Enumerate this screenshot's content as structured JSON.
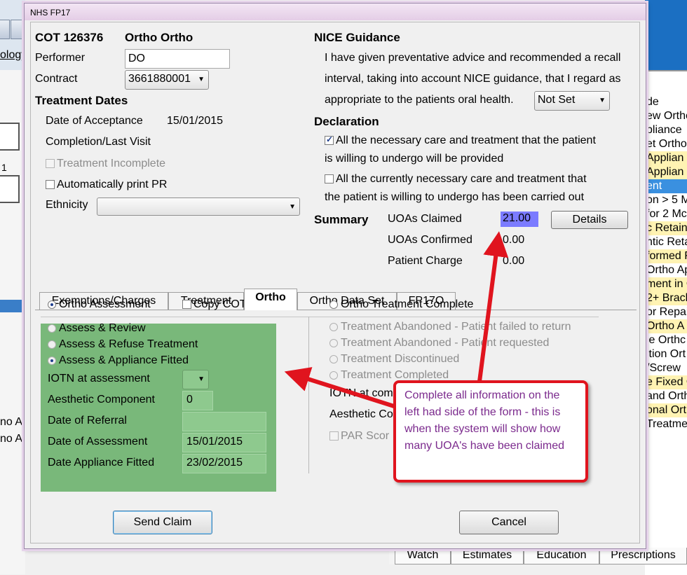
{
  "window": {
    "title": "NHS FP17"
  },
  "header": {
    "cot": "COT 126376",
    "patient_name": "Ortho Ortho"
  },
  "performer": {
    "label": "Performer",
    "value": "DO"
  },
  "contract": {
    "label": "Contract",
    "value": "3661880001"
  },
  "treatment_dates": {
    "heading": "Treatment Dates",
    "acceptance_label": "Date of Acceptance",
    "acceptance_value": "15/01/2015",
    "completion_label": "Completion/Last Visit",
    "incomplete_label": "Treatment Incomplete",
    "auto_print_label": "Automatically print PR",
    "ethnicity_label": "Ethnicity",
    "ethnicity_value": ""
  },
  "nice": {
    "heading": "NICE Guidance",
    "line1": "I have given preventative advice and recommended a recall",
    "line2": "interval, taking into account NICE guidance, that I regard as",
    "line3": "appropriate to the patients oral health.",
    "select_value": "Not Set"
  },
  "declaration": {
    "heading": "Declaration",
    "item1_line1": "All the necessary care and treatment that the patient",
    "item1_line2": "is willing to undergo will be provided",
    "item1_checked": true,
    "item2_line1": "All the currently necessary care and treatment that",
    "item2_line2": "the patient is willing to undergo has been carried out",
    "item2_checked": false
  },
  "summary": {
    "heading": "Summary",
    "uoas_claimed_label": "UOAs Claimed",
    "uoas_claimed_value": "21.00",
    "uoas_confirmed_label": "UOAs Confirmed",
    "uoas_confirmed_value": "0.00",
    "patient_charge_label": "Patient Charge",
    "patient_charge_value": "0.00",
    "details_button": "Details"
  },
  "tabs": [
    {
      "label": "Exemptions/Charges"
    },
    {
      "label": "Treatment"
    },
    {
      "label": "Ortho"
    },
    {
      "label": "Ortho Data Set"
    },
    {
      "label": "FP17O"
    }
  ],
  "ortho": {
    "assessment_label": "Ortho Assessment",
    "copy_cot_label": "Copy COT",
    "treatment_complete_label": "Ortho Treatment Complete",
    "assess_review": "Assess & Review",
    "assess_refuse": "Assess & Refuse Treatment",
    "assess_fitted": "Assess & Appliance Fitted",
    "iotn_label": "IOTN at assessment",
    "iotn_value": "",
    "aesthetic_label": "Aesthetic Component",
    "aesthetic_value": "0",
    "referral_label": "Date of Referral",
    "referral_value": "",
    "assessment_date_label": "Date of Assessment",
    "assessment_date_value": "15/01/2015",
    "fitted_label": "Date Appliance Fitted",
    "fitted_value": "23/02/2015",
    "abandoned_failed": "Treatment Abandoned - Patient failed to return",
    "abandoned_requested": "Treatment Abandoned - Patient requested",
    "discontinued": "Treatment Discontinued",
    "completed": "Treatment Completed",
    "iotn_completion_label": "IOTN at com",
    "aesthetic_completion_label": "Aesthetic Co",
    "par_label": "PAR Scor"
  },
  "buttons": {
    "send_claim": "Send Claim",
    "cancel": "Cancel"
  },
  "callout": {
    "text": "Complete all information on the left had side of the form - this is when the system will show how many UOA's have been claimed"
  },
  "background": {
    "left_texts": [
      "ology",
      "1",
      "no Ap",
      "no Ap"
    ],
    "right_list": [
      "de",
      "ew Orthc",
      "pliance",
      "et Ortho",
      "Applian",
      "Applian",
      "ent",
      "on > 5 M",
      "for 2 Mc",
      "c Retain",
      "ntic Reta",
      "formed F",
      "Ortho Ap",
      "ment in C",
      "2+ Brack",
      "or Repai",
      "Ortho A",
      "le Orthc",
      "ition Ort",
      "/Screw",
      "e Fixed C",
      "and Orth",
      "onal Ort",
      "Treatme"
    ],
    "bottom_tabs": [
      "Watch",
      "Estimates",
      "Education",
      "Prescriptions"
    ]
  },
  "colors": {
    "callout_border": "#e0141e",
    "callout_text": "#7b2a8d",
    "green_panel": "#79b87a",
    "uoa_highlight": "#7b7bff"
  }
}
